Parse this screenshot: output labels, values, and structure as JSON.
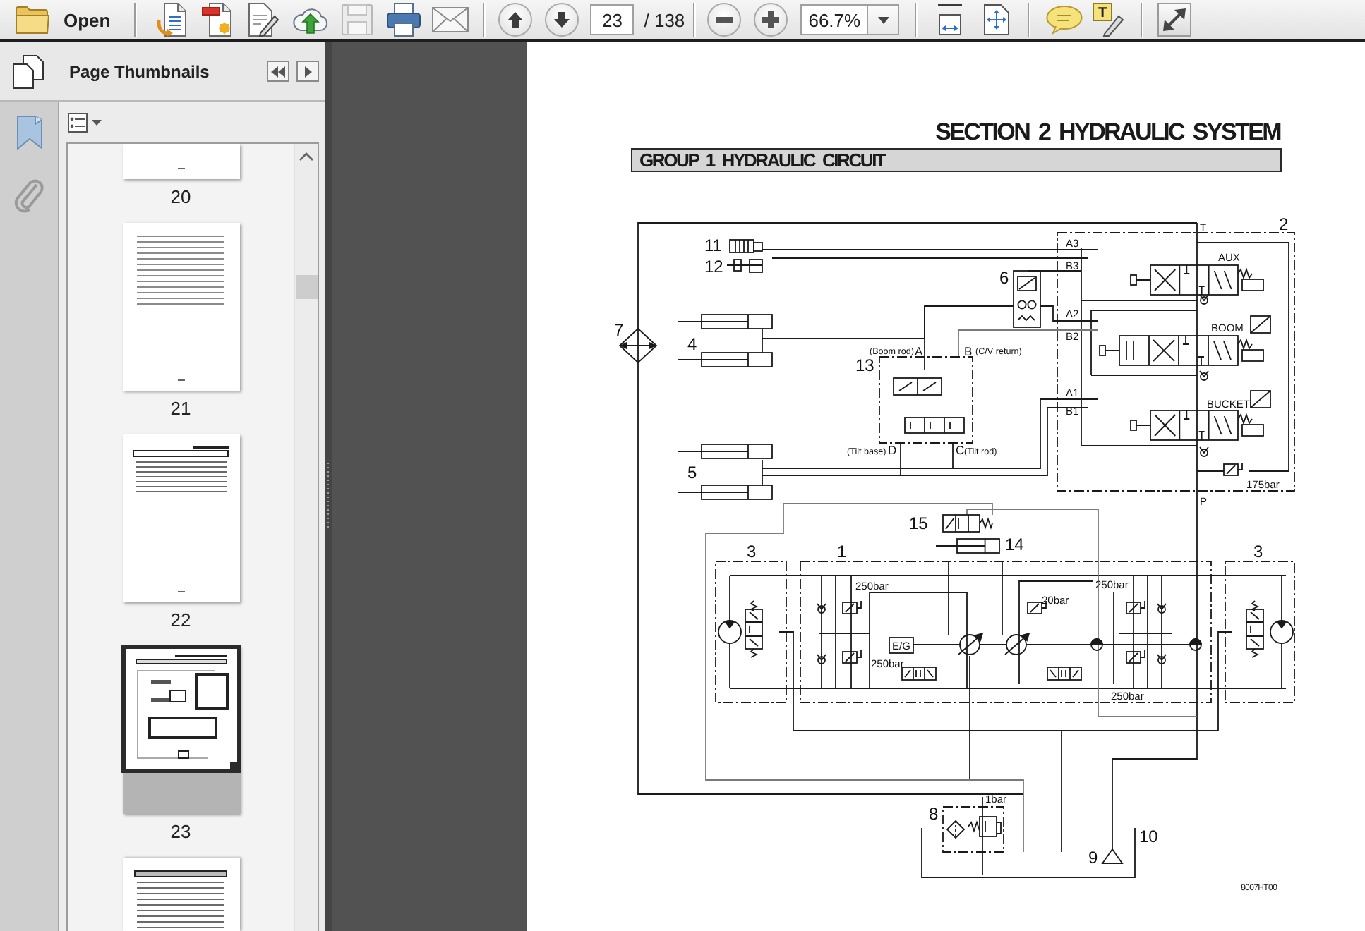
{
  "toolbar": {
    "open_label": "Open",
    "save_disabled": true,
    "page_number": "23",
    "page_count": "/ 138",
    "zoom": "66.7%",
    "text_tool_glyph": "T"
  },
  "sidebar": {
    "title": "Page Thumbnails",
    "thumbnails": [
      {
        "label": "20",
        "kind": "text",
        "selected": false
      },
      {
        "label": "21",
        "kind": "text",
        "selected": false
      },
      {
        "label": "22",
        "kind": "contents",
        "selected": false
      },
      {
        "label": "23",
        "kind": "diagram",
        "selected": true
      },
      {
        "kind": "section",
        "selected": false
      }
    ]
  },
  "document": {
    "section_title": "SECTION 2 HYDRAULIC SYSTEM",
    "group_title": "GROUP 1 HYDRAULIC CIRCUIT",
    "diagram": {
      "part_numbers": [
        "11",
        "12",
        "6",
        "2",
        "7",
        "4",
        "13",
        "5",
        "15",
        "14",
        "3",
        "1",
        "3",
        "8",
        "9",
        "10"
      ],
      "port_labels": [
        "A3",
        "B3",
        "A2",
        "B2",
        "A1",
        "B1",
        "T",
        "P",
        "A",
        "B",
        "D",
        "C"
      ],
      "valve_names": [
        "AUX",
        "BOOM",
        "BUCKET"
      ],
      "pressure_settings": [
        "175bar",
        "250bar",
        "250bar",
        "250bar",
        "250bar",
        "20bar",
        "1bar"
      ],
      "port_notes": [
        "(Boom rod)",
        "(C/V return)",
        "(Tilt base)",
        "(Tilt rod)"
      ],
      "engine_label": "E/G",
      "figure_code": "8007HT00"
    }
  }
}
